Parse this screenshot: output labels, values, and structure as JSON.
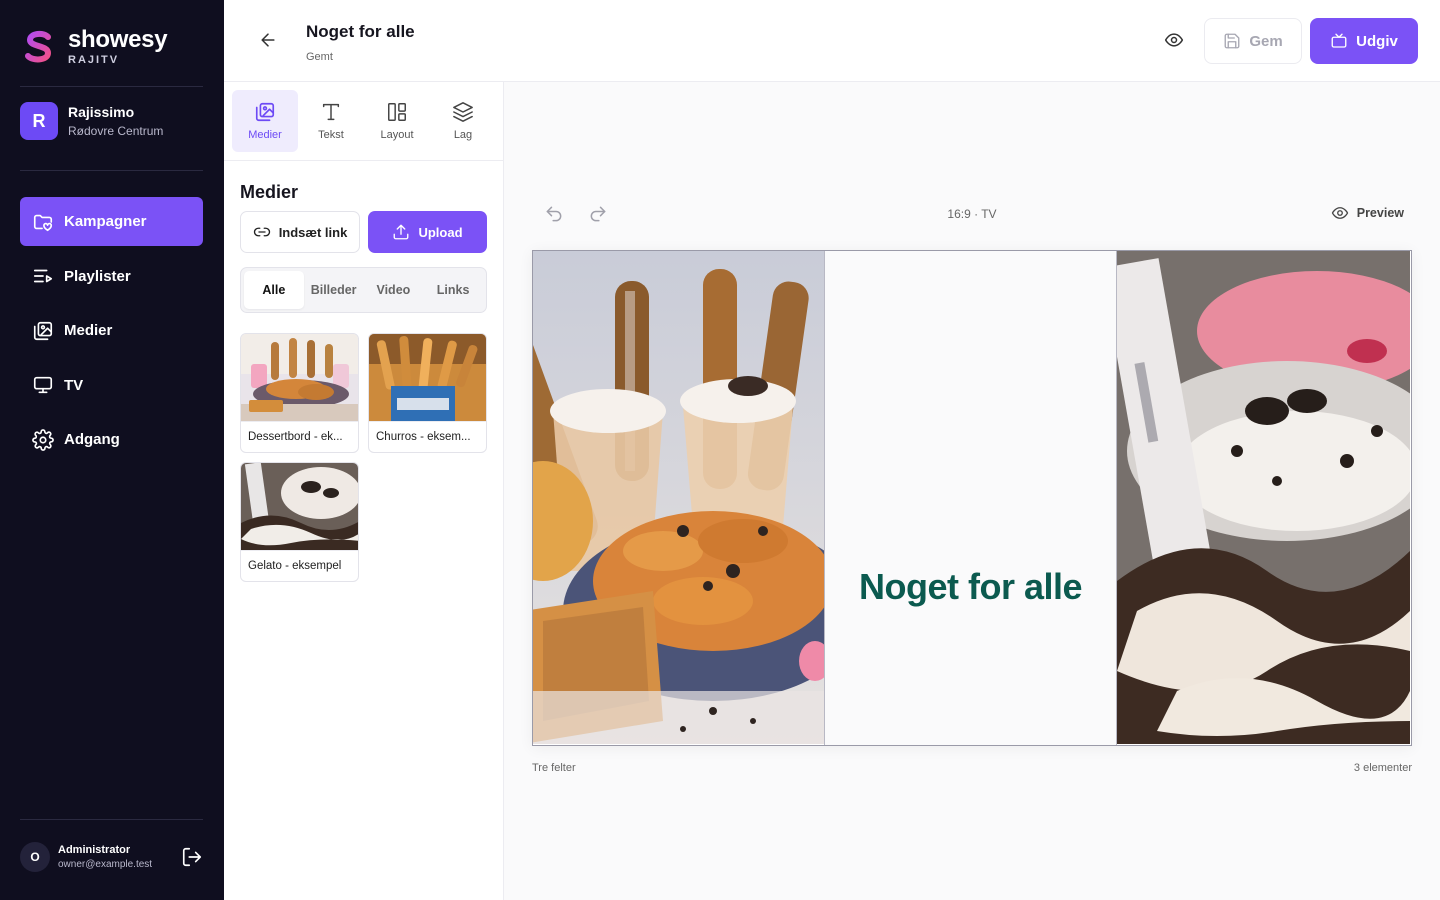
{
  "brand": {
    "name": "showesy",
    "sub": "RAJITV",
    "accent": "#7b52f6"
  },
  "org": {
    "initial": "R",
    "name": "Rajissimo",
    "location": "Rødovre Centrum"
  },
  "nav": {
    "items": [
      {
        "label": "Kampagner",
        "icon": "folder-icon",
        "active": true
      },
      {
        "label": "Playlister",
        "icon": "playlist-icon"
      },
      {
        "label": "Medier",
        "icon": "images-icon"
      },
      {
        "label": "TV",
        "icon": "monitor-icon"
      },
      {
        "label": "Adgang",
        "icon": "gear-icon"
      }
    ]
  },
  "user": {
    "initial": "O",
    "name": "Administrator",
    "email": "owner@example.test"
  },
  "header": {
    "title": "Noget for alle",
    "status": "Gemt",
    "save_label": "Gem",
    "publish_label": "Udgiv"
  },
  "panel": {
    "tools": [
      {
        "label": "Medier",
        "active": true
      },
      {
        "label": "Tekst"
      },
      {
        "label": "Layout"
      },
      {
        "label": "Lag"
      }
    ],
    "title": "Medier",
    "insert_link_label": "Indsæt link",
    "upload_label": "Upload",
    "filters": [
      "Alle",
      "Billeder",
      "Video",
      "Links"
    ],
    "media": [
      {
        "label": "Dessertbord - ek..."
      },
      {
        "label": "Churros - eksem..."
      },
      {
        "label": "Gelato - eksempel"
      }
    ]
  },
  "canvas": {
    "ratio": "16:9 · TV",
    "preview_label": "Preview",
    "zone_text": "Noget for alle",
    "layout_name": "Tre felter",
    "element_count": "3 elementer"
  }
}
